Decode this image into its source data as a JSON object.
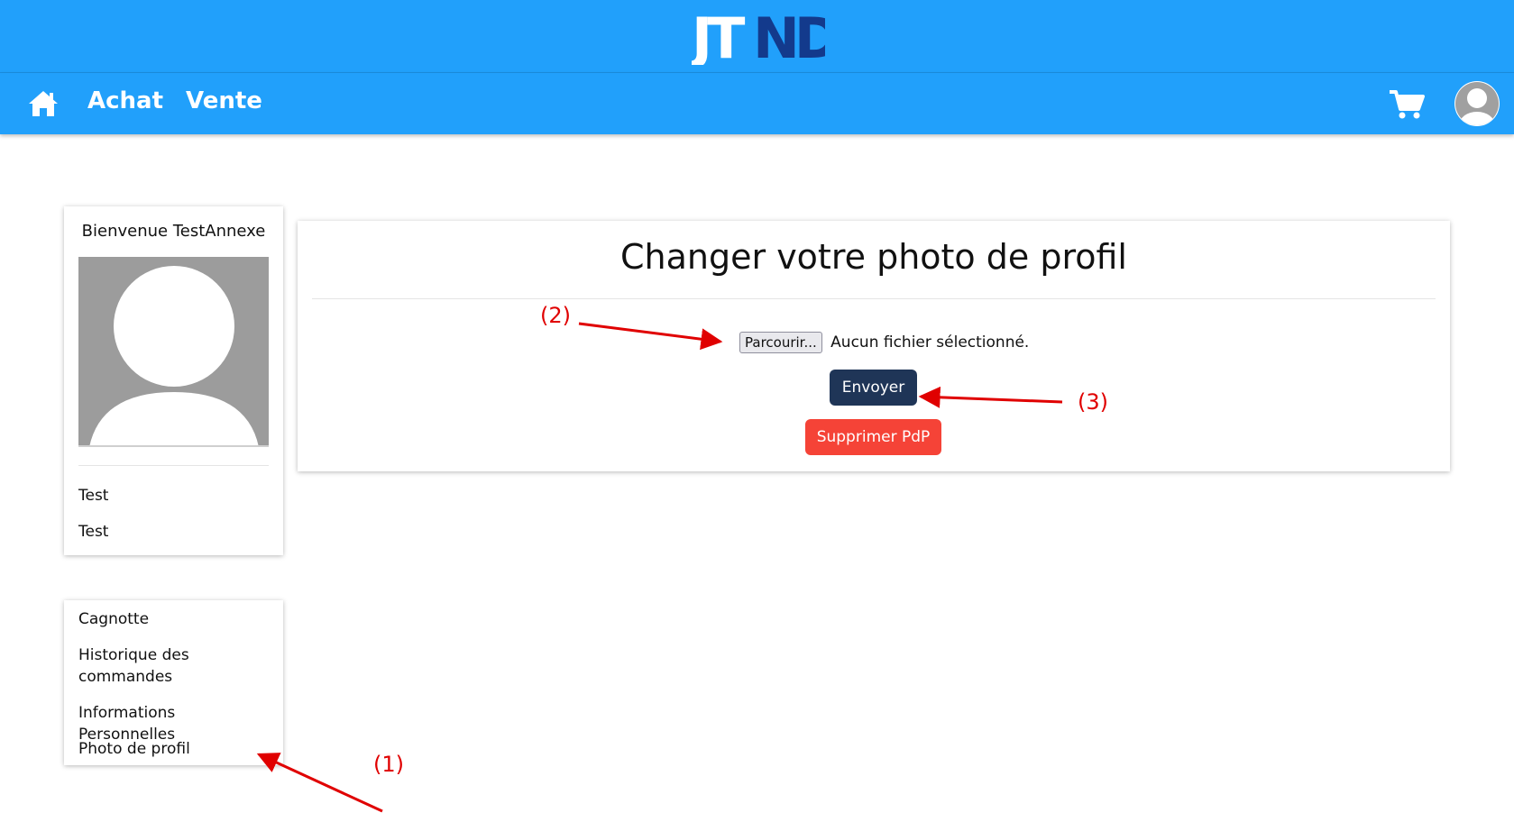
{
  "header": {
    "logo_text_left": "JT",
    "logo_text_right": "ND",
    "logo_icon": "jtnd-logo"
  },
  "nav": {
    "home_icon": "home-icon",
    "links": [
      {
        "label": "Achat"
      },
      {
        "label": "Vente"
      }
    ],
    "cart_icon": "cart-icon",
    "account_icon": "account-avatar-icon"
  },
  "profile_card": {
    "welcome": "Bienvenue TestAnnexe",
    "lines": [
      "Test",
      "Test"
    ]
  },
  "menu": {
    "items": [
      {
        "label": "Cagnotte"
      },
      {
        "label": "Historique des commandes"
      },
      {
        "label": "Informations Personnelles"
      },
      {
        "label": "Photo de profil"
      }
    ]
  },
  "main": {
    "title": "Changer votre photo de profil",
    "file_button": "Parcourir...",
    "file_status": "Aucun fichier sélectionné.",
    "send_label": "Envoyer",
    "delete_label": "Supprimer PdP"
  },
  "annotations": {
    "step1": "(1)",
    "step2": "(2)",
    "step3": "(3)"
  },
  "colors": {
    "header_bg": "#21a0fb",
    "logo_dark": "#133a8c",
    "send_button": "#1f3557",
    "delete_button": "#f54337",
    "annotation_red": "#e00000"
  }
}
